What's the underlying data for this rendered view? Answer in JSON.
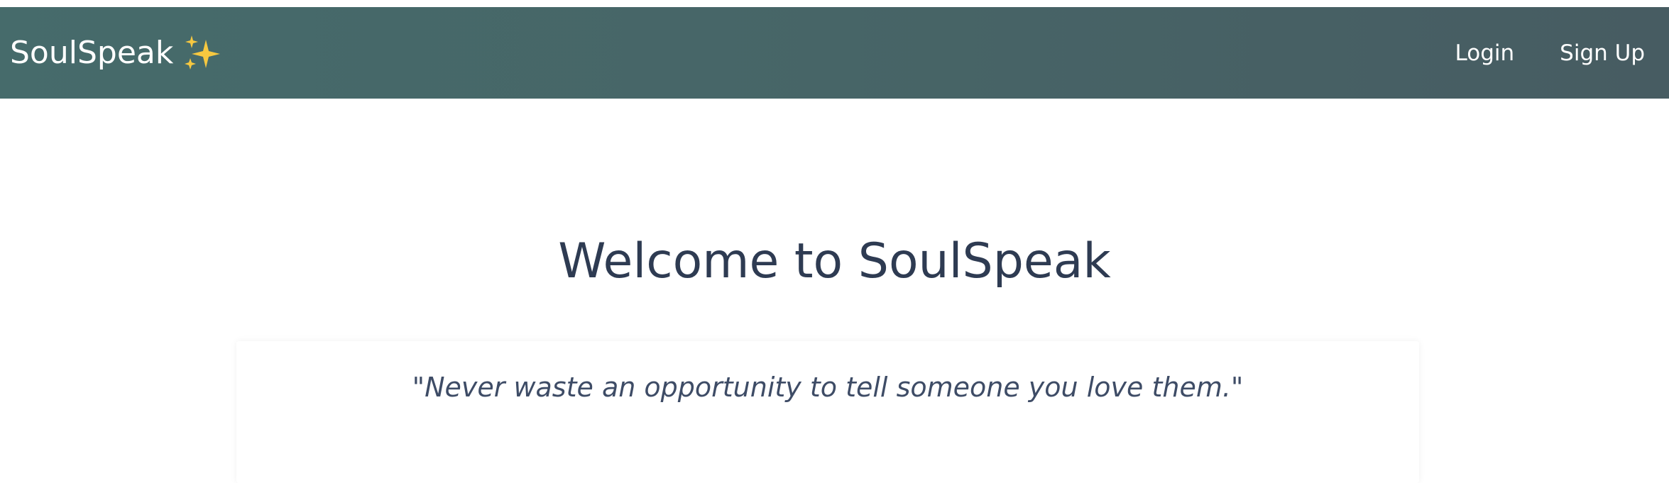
{
  "navbar": {
    "brand": "SoulSpeak",
    "brand_icon": "sparkles-icon",
    "links": [
      {
        "label": "Login"
      },
      {
        "label": "Sign Up"
      }
    ],
    "colors": {
      "start": "#466b6b",
      "end": "#475c62",
      "text": "#ffffff"
    }
  },
  "main": {
    "title": "Welcome to SoulSpeak",
    "quote": "\"Never waste an opportunity to tell someone you love them.\"",
    "colors": {
      "title": "#2e3b52",
      "quote": "#3e4c66"
    }
  }
}
